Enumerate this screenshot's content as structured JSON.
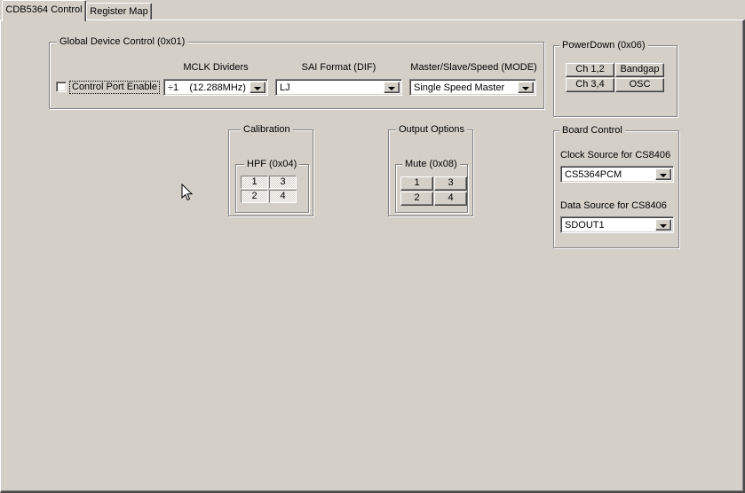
{
  "tabs": [
    {
      "label": "CDB5364 Control",
      "active": true
    },
    {
      "label": "Register Map",
      "active": false
    }
  ],
  "global_device": {
    "title": "Global Device Control (0x01)",
    "checkbox_label": "Control Port Enable",
    "checkbox_checked": false,
    "mclk": {
      "label": "MCLK Dividers",
      "value": "÷1    (12.288MHz)"
    },
    "sai": {
      "label": "SAI Format (DIF)",
      "value": "LJ"
    },
    "mode": {
      "label": "Master/Slave/Speed (MODE)",
      "value": "Single Speed Master"
    }
  },
  "powerdown": {
    "title": "PowerDown (0x06)",
    "buttons": [
      "Ch 1,2",
      "Bandgap",
      "Ch 3,4",
      "OSC"
    ]
  },
  "calibration": {
    "title": "Calibration",
    "hpf": {
      "title": "HPF (0x04)",
      "buttons": [
        "1",
        "3",
        "2",
        "4"
      ],
      "checked": true
    }
  },
  "output_options": {
    "title": "Output Options",
    "mute": {
      "title": "Mute (0x08)",
      "buttons": [
        "1",
        "3",
        "2",
        "4"
      ],
      "checked": false
    }
  },
  "board_control": {
    "title": "Board Control",
    "clock": {
      "label": "Clock Source for CS8406",
      "value": "CS5364PCM"
    },
    "data": {
      "label": "Data Source for CS8406",
      "value": "SDOUT1"
    }
  },
  "colors": {
    "face": "#d4d0c8",
    "highlight": "#ffffff",
    "shadow": "#808080",
    "dark_shadow": "#404040",
    "text": "#000000",
    "field_bg": "#ffffff"
  }
}
